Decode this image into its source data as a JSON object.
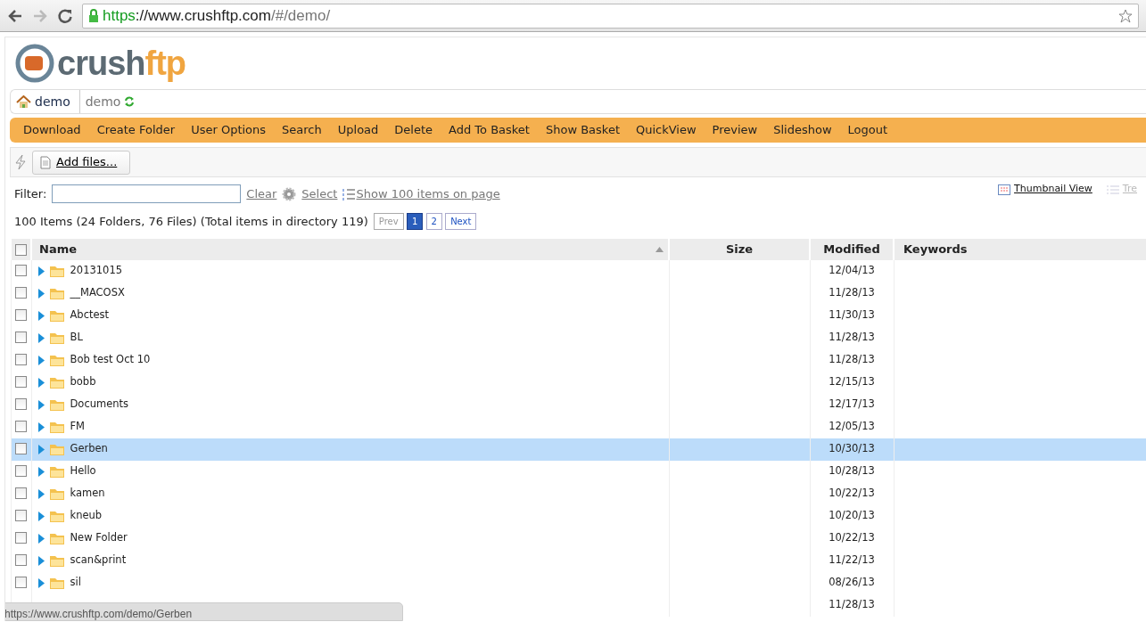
{
  "browser": {
    "url_scheme": "https",
    "url_host": "://www.crushftp.com",
    "url_path": "/#/demo/"
  },
  "logo": {
    "part_1": "crush",
    "part_2": "ftp"
  },
  "breadcrumb": [
    {
      "label": "demo",
      "kind": "home"
    },
    {
      "label": "demo",
      "kind": "current"
    }
  ],
  "menu": [
    "Download",
    "Create Folder",
    "User Options",
    "Search",
    "Upload",
    "Delete",
    "Add To Basket",
    "Show Basket",
    "QuickView",
    "Preview",
    "Slideshow",
    "Logout"
  ],
  "toolbar": {
    "add_files": "Add files..."
  },
  "filter": {
    "label": "Filter:",
    "clear": "Clear",
    "select": "Select",
    "show_items": "Show 100 items on page"
  },
  "views": [
    {
      "label": "Thumbnail View",
      "disabled": false
    },
    {
      "label": "Tre",
      "disabled": true
    }
  ],
  "summary": "100 Items (24 Folders, 76 Files) (Total items in directory 119)",
  "pagination": [
    {
      "label": "Prev",
      "selected": false,
      "disabled": true
    },
    {
      "label": "1",
      "selected": true,
      "disabled": false
    },
    {
      "label": "2",
      "selected": false,
      "disabled": false
    },
    {
      "label": "Next",
      "selected": false,
      "disabled": false
    }
  ],
  "table": {
    "select_all": {
      "checked": false
    },
    "columns": [
      "Name",
      "Size",
      "Modified",
      "Keywords"
    ],
    "rows": [
      {
        "name": "20131015",
        "modified": "12/04/13",
        "selected": false,
        "checked": false
      },
      {
        "name": "__MACOSX",
        "modified": "11/28/13",
        "selected": false,
        "checked": false
      },
      {
        "name": "Abctest",
        "modified": "11/30/13",
        "selected": false,
        "checked": false
      },
      {
        "name": "BL",
        "modified": "11/28/13",
        "selected": false,
        "checked": false
      },
      {
        "name": "Bob test Oct 10",
        "modified": "11/28/13",
        "selected": false,
        "checked": false
      },
      {
        "name": "bobb",
        "modified": "12/15/13",
        "selected": false,
        "checked": false
      },
      {
        "name": "Documents",
        "modified": "12/17/13",
        "selected": false,
        "checked": false
      },
      {
        "name": "FM",
        "modified": "12/05/13",
        "selected": false,
        "checked": false
      },
      {
        "name": "Gerben",
        "modified": "10/30/13",
        "selected": true,
        "checked": false
      },
      {
        "name": "Hello",
        "modified": "10/28/13",
        "selected": false,
        "checked": false
      },
      {
        "name": "kamen",
        "modified": "10/22/13",
        "selected": false,
        "checked": false
      },
      {
        "name": "kneub",
        "modified": "10/20/13",
        "selected": false,
        "checked": false
      },
      {
        "name": "New Folder",
        "modified": "10/22/13",
        "selected": false,
        "checked": false
      },
      {
        "name": "scan&print",
        "modified": "11/22/13",
        "selected": false,
        "checked": false
      },
      {
        "name": "sil",
        "modified": "08/26/13",
        "selected": false,
        "checked": false
      },
      {
        "modified": "11/28/13",
        "selected": false
      }
    ]
  },
  "status_bar": "https://www.crushftp.com/demo/Gerben"
}
